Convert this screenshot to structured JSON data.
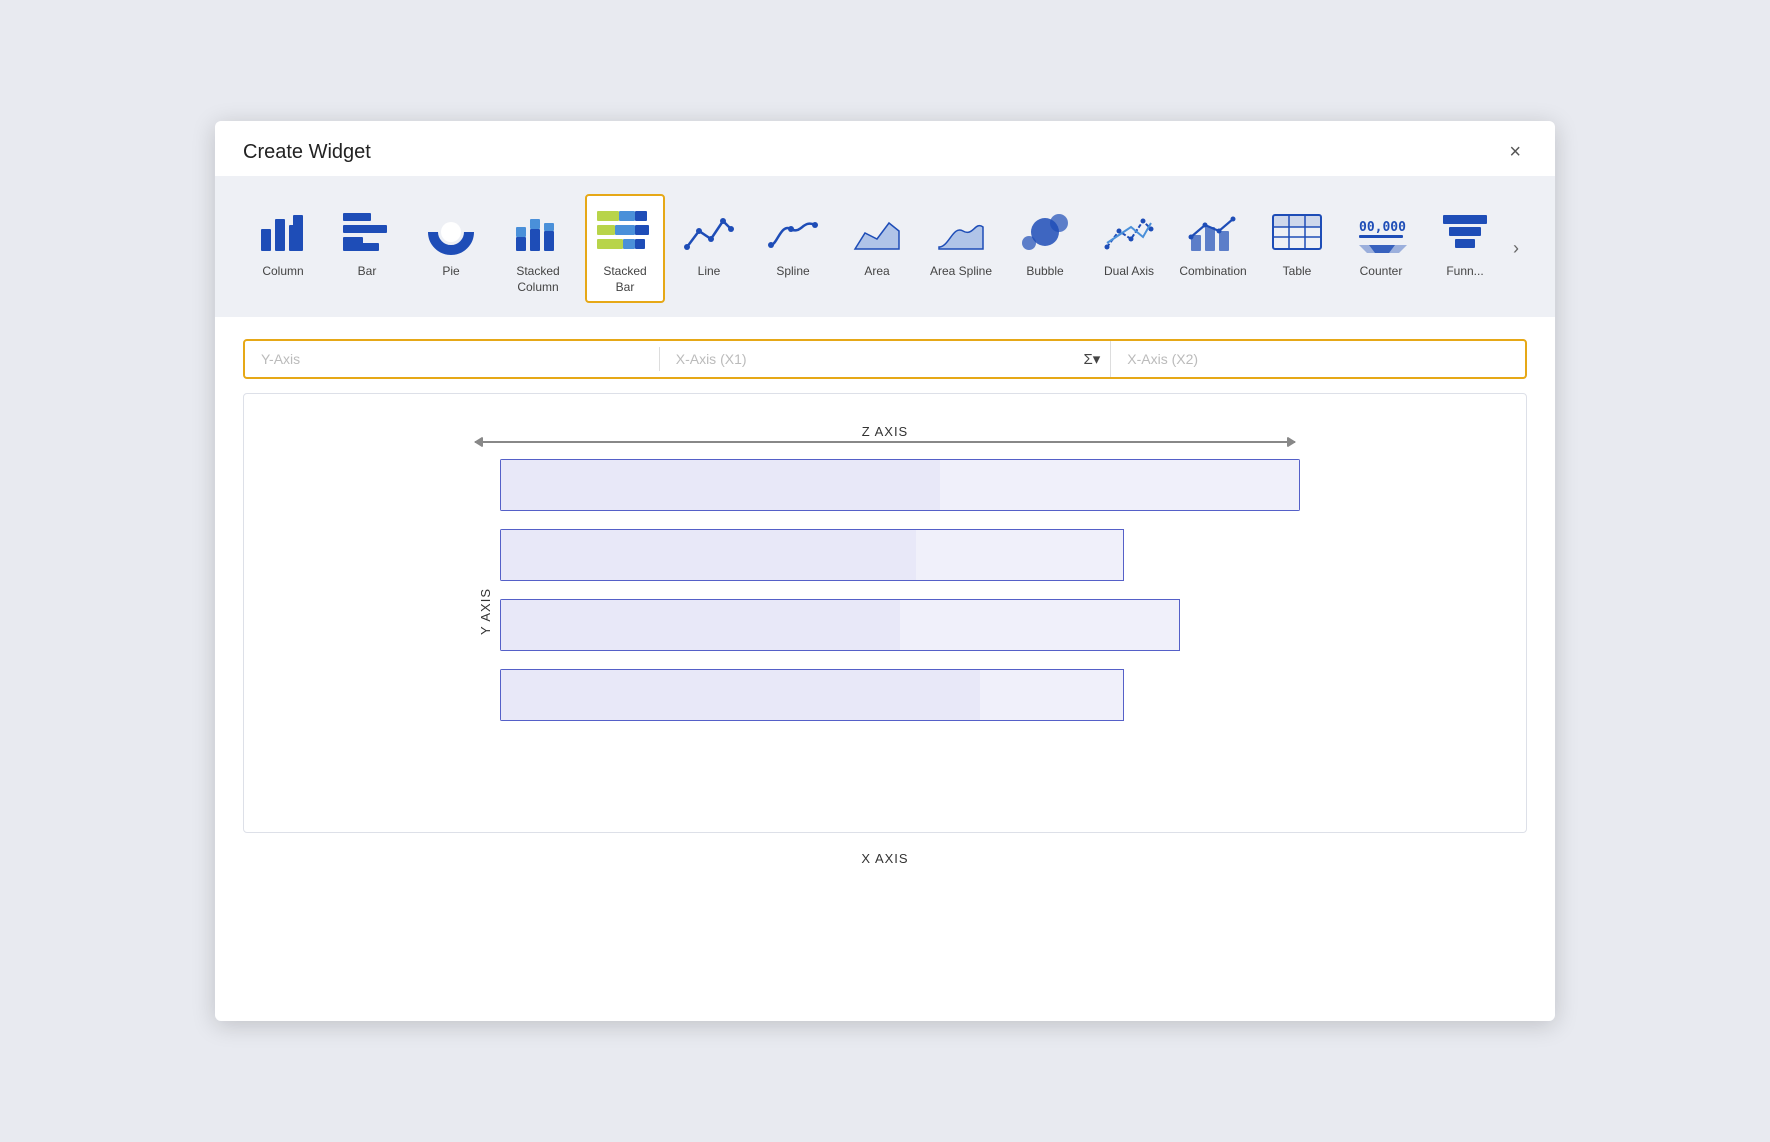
{
  "dialog": {
    "title": "Create Widget",
    "close_label": "×"
  },
  "chart_types": [
    {
      "id": "column",
      "label": "Column",
      "active": false
    },
    {
      "id": "bar",
      "label": "Bar",
      "active": false
    },
    {
      "id": "pie",
      "label": "Pie",
      "active": false
    },
    {
      "id": "stacked-column",
      "label": "Stacked Column",
      "active": false
    },
    {
      "id": "stacked-bar",
      "label": "Stacked Bar",
      "active": true
    },
    {
      "id": "line",
      "label": "Line",
      "active": false
    },
    {
      "id": "spline",
      "label": "Spline",
      "active": false
    },
    {
      "id": "area",
      "label": "Area",
      "active": false
    },
    {
      "id": "area-spline",
      "label": "Area Spline",
      "active": false
    },
    {
      "id": "bubble",
      "label": "Bubble",
      "active": false
    },
    {
      "id": "dual-axis",
      "label": "Dual Axis",
      "active": false
    },
    {
      "id": "combination",
      "label": "Combination",
      "active": false
    },
    {
      "id": "table",
      "label": "Table",
      "active": false
    },
    {
      "id": "counter",
      "label": "Counter",
      "active": false
    },
    {
      "id": "funnel",
      "label": "Funn...",
      "active": false
    }
  ],
  "scroll_arrow": ">",
  "axis": {
    "y_placeholder": "Y-Axis",
    "x1_placeholder": "X-Axis (X1)",
    "sigma_label": "Σ",
    "dropdown_arrow": "▾",
    "x2_placeholder": "X-Axis (X2)"
  },
  "chart_preview": {
    "z_axis_label": "Z AXIS",
    "y_axis_label": "Y AXIS",
    "x_axis_label": "X AXIS",
    "bars": [
      {
        "seg1_pct": 55,
        "seg2_pct": 45
      },
      {
        "seg1_pct": 52,
        "seg2_pct": 28
      },
      {
        "seg1_pct": 50,
        "seg2_pct": 35
      },
      {
        "seg1_pct": 58,
        "seg2_pct": 22
      }
    ]
  },
  "colors": {
    "active_border": "#e6a817",
    "bar_fill": "#e8e8f8",
    "bar_border": "#5560c8",
    "icon_blue": "#1e4db7"
  }
}
